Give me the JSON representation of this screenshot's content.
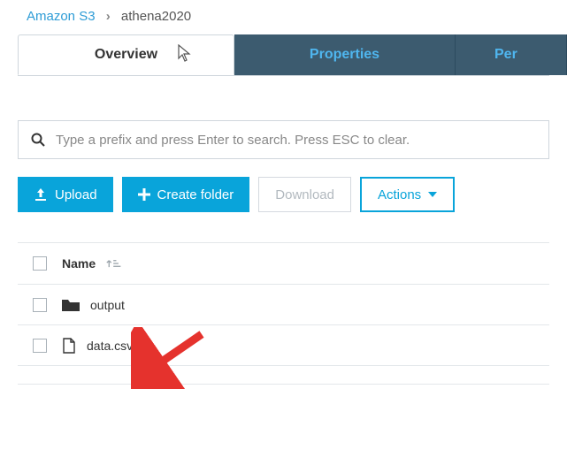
{
  "breadcrumb": {
    "root": "Amazon S3",
    "current": "athena2020"
  },
  "tabs": {
    "overview": "Overview",
    "properties": "Properties",
    "permissions": "Per"
  },
  "search": {
    "placeholder": "Type a prefix and press Enter to search. Press ESC to clear."
  },
  "toolbar": {
    "upload": "Upload",
    "create_folder": "Create folder",
    "download": "Download",
    "actions": "Actions"
  },
  "columns": {
    "name": "Name"
  },
  "items": [
    {
      "name": "output",
      "type": "folder"
    },
    {
      "name": "data.csv",
      "type": "file"
    }
  ],
  "colors": {
    "accent": "#09a4da",
    "tab_bg": "#3c5b6f"
  }
}
